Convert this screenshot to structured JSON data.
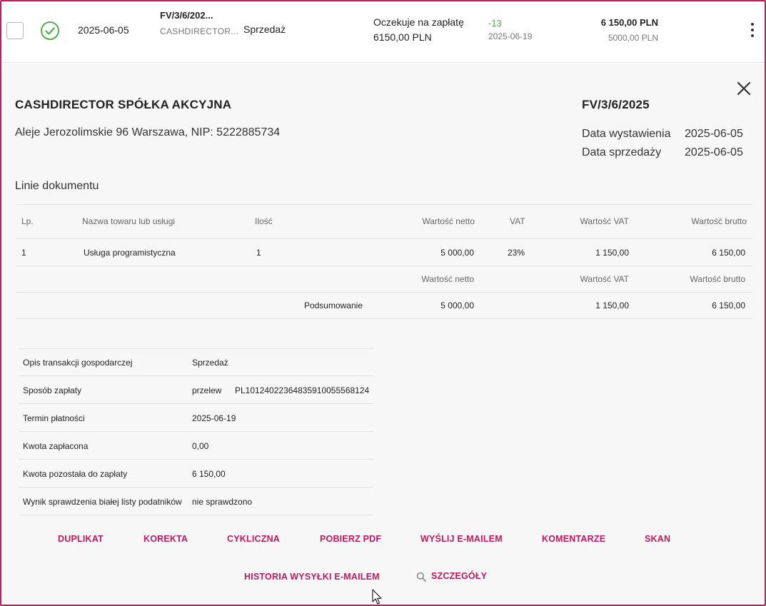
{
  "row": {
    "date": "2025-06-05",
    "invoice_number": "FV/3/6/202...",
    "company_short": "CASHDIRECTOR...",
    "type": "Sprzedaż",
    "status": "Oczekuje na zapłatę",
    "status_amount": "6150,00 PLN",
    "days": "-13",
    "due_date": "2025-06-19",
    "gross": "6 150,00 PLN",
    "net": "5000,00 PLN"
  },
  "details": {
    "company": "CASHDIRECTOR SPÓŁKA AKCYJNA",
    "address": "Aleje Jerozolimskie 96 Warszawa, NIP: 5222885734",
    "invoice_number": "FV/3/6/2025",
    "issue_label": "Data wystawienia",
    "issue_date": "2025-06-05",
    "sale_label": "Data sprzedaży",
    "sale_date": "2025-06-05",
    "lines_title": "Linie dokumentu"
  },
  "lines": {
    "headers": {
      "lp": "Lp.",
      "name": "Nazwa towaru lub usługi",
      "qty": "Ilość",
      "net": "Wartość netto",
      "vat": "VAT",
      "vat_value": "Wartość VAT",
      "gross": "Wartość brutto"
    },
    "rows": [
      {
        "lp": "1",
        "name": "Usługa programistyczna",
        "qty": "1",
        "net": "5 000,00",
        "vat": "23%",
        "vat_value": "1 150,00",
        "gross": "6 150,00"
      }
    ],
    "summary_headers": {
      "net": "Wartość netto",
      "vat_value": "Wartość VAT",
      "gross": "Wartość brutto"
    },
    "summary": {
      "label": "Podsumowanie",
      "net": "5 000,00",
      "vat_value": "1 150,00",
      "gross": "6 150,00"
    }
  },
  "info": [
    {
      "label": "Opis transakcji gospodarczej",
      "value": "Sprzedaż",
      "extra": ""
    },
    {
      "label": "Sposób zapłaty",
      "value": "przelew",
      "extra": "PL10124022364835910055568124"
    },
    {
      "label": "Termin płatności",
      "value": "2025-06-19",
      "extra": ""
    },
    {
      "label": "Kwota zapłacona",
      "value": "0,00",
      "extra": ""
    },
    {
      "label": "Kwota pozostała do zapłaty",
      "value": "6 150,00",
      "extra": ""
    },
    {
      "label": "Wynik sprawdzenia białej listy podatników",
      "value": "nie sprawdzono",
      "extra": ""
    }
  ],
  "actions": {
    "duplicate": "DUPLIKAT",
    "correction": "KOREKTA",
    "cyclic": "CYKLICZNA",
    "download_pdf": "POBIERZ PDF",
    "send_email": "WYŚLIJ E-MAILEM",
    "comments": "KOMENTARZE",
    "scan": "SKAN",
    "email_history": "HISTORIA WYSYŁKI E-MAILEM",
    "details": "SZCZEGÓŁY"
  },
  "colors": {
    "accent": "#c2185b",
    "border": "#c8185e",
    "success": "#4caf50"
  }
}
